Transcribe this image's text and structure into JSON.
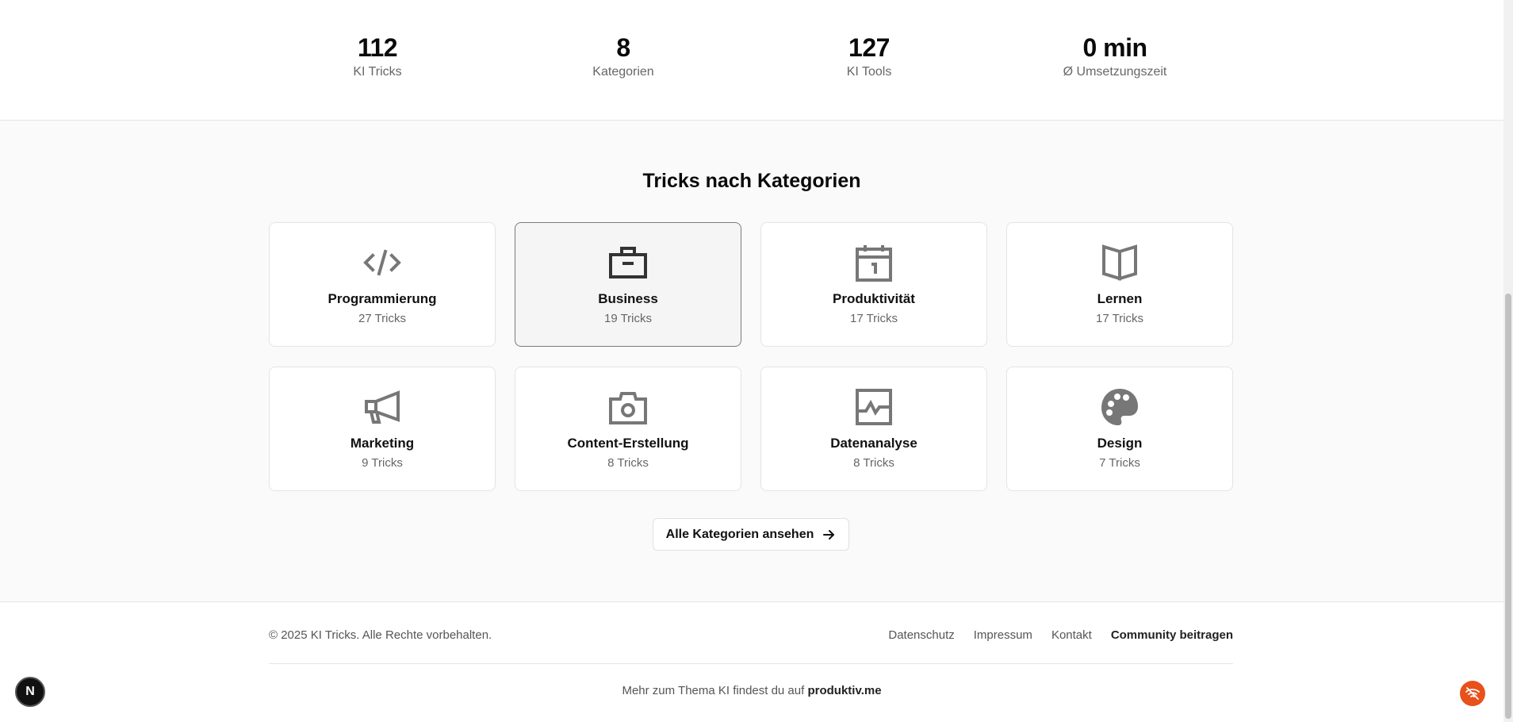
{
  "stats": [
    {
      "value": "112",
      "label": "KI Tricks"
    },
    {
      "value": "8",
      "label": "Kategorien"
    },
    {
      "value": "127",
      "label": "KI Tools"
    },
    {
      "value": "0 min",
      "label": "Ø Umsetzungszeit"
    }
  ],
  "categories_section": {
    "title": "Tricks nach Kategorien",
    "items": [
      {
        "name": "Programmierung",
        "count": "27 Tricks",
        "icon": "code-icon"
      },
      {
        "name": "Business",
        "count": "19 Tricks",
        "icon": "briefcase-icon"
      },
      {
        "name": "Produktivität",
        "count": "17 Tricks",
        "icon": "calendar-icon"
      },
      {
        "name": "Lernen",
        "count": "17 Tricks",
        "icon": "book-open-icon"
      },
      {
        "name": "Marketing",
        "count": "9 Tricks",
        "icon": "megaphone-icon"
      },
      {
        "name": "Content-Erstellung",
        "count": "8 Tricks",
        "icon": "camera-icon"
      },
      {
        "name": "Datenanalyse",
        "count": "8 Tricks",
        "icon": "chart-icon"
      },
      {
        "name": "Design",
        "count": "7 Tricks",
        "icon": "palette-icon"
      }
    ],
    "all_button": "Alle Kategorien ansehen"
  },
  "footer": {
    "copyright": "© 2025 KI Tricks. Alle Rechte vorbehalten.",
    "links": [
      "Datenschutz",
      "Impressum",
      "Kontakt",
      "Community beitragen"
    ],
    "more_prefix": "Mehr zum Thema KI findest du auf",
    "more_link": "produktiv.me"
  },
  "widgets": {
    "next_badge": "N"
  },
  "colors": {
    "accent_widget": "#e8511c",
    "icon_gray": "#777777"
  }
}
